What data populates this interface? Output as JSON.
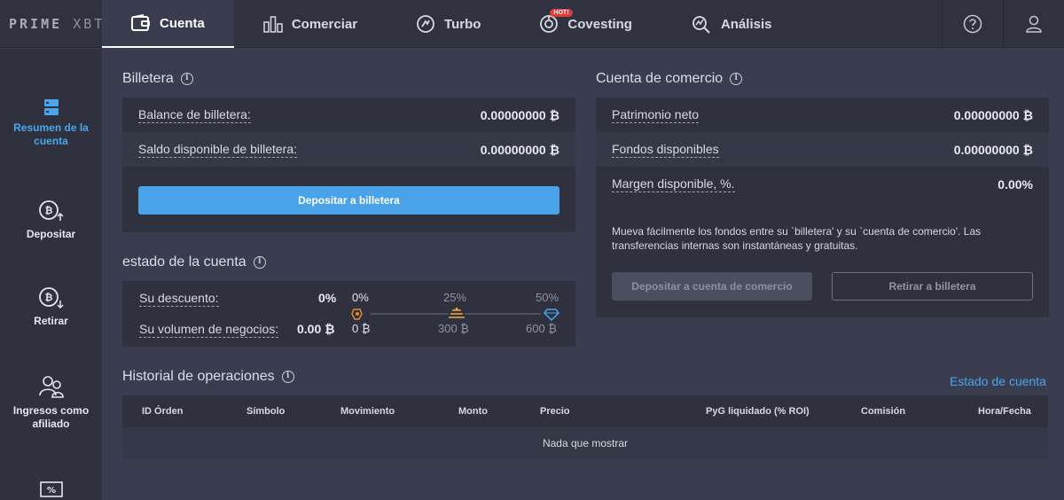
{
  "logo": {
    "brand": "PRIME",
    "suffix": "XBT"
  },
  "nav": [
    {
      "label": "Cuenta",
      "icon": "wallet-icon",
      "active": true
    },
    {
      "label": "Comerciar",
      "icon": "bar-chart-icon"
    },
    {
      "label": "Turbo",
      "icon": "turbo-icon"
    },
    {
      "label": "Covesting",
      "icon": "covesting-icon",
      "badge": "HOT!"
    },
    {
      "label": "Análisis",
      "icon": "analysis-icon"
    }
  ],
  "topright": {
    "help_icon": "help-icon",
    "user_icon": "user-icon"
  },
  "sidebar": [
    {
      "label": "Resumen de la cuenta",
      "icon": "summary-icon",
      "active": true
    },
    {
      "label": "Depositar",
      "icon": "deposit-icon"
    },
    {
      "label": "Retirar",
      "icon": "withdraw-icon"
    },
    {
      "label": "Ingresos como afiliado",
      "icon": "affiliate-icon"
    },
    {
      "label": "",
      "icon": "percent-icon"
    }
  ],
  "wallet": {
    "title": "Billetera",
    "balance_label": "Balance de billetera:",
    "balance_value": "0.00000000 ₿",
    "available_label": "Saldo disponible de billetera:",
    "available_value": "0.00000000 ₿",
    "deposit_button": "Depositar a billetera"
  },
  "account_status": {
    "title": "estado de la cuenta",
    "discount_label": "Su descuento:",
    "discount_value": "0%",
    "volume_label": "Su volumen de negocios:",
    "volume_value": "0.00 ₿",
    "tiers": [
      {
        "pct": "0%",
        "volume": "0 ₿",
        "icon": "tier-bronze-icon"
      },
      {
        "pct": "25%",
        "volume": "300 ₿",
        "icon": "tier-gold-icon"
      },
      {
        "pct": "50%",
        "volume": "600 ₿",
        "icon": "tier-diamond-icon"
      }
    ]
  },
  "trading_account": {
    "title": "Cuenta de comercio",
    "equity_label": "Patrimonio neto",
    "equity_value": "0.00000000 ₿",
    "funds_label": "Fondos disponibles",
    "funds_value": "0.00000000 ₿",
    "margin_label": "Margen disponible, %.",
    "margin_value": "0.00%",
    "note": "Mueva fácilmente los fondos entre su `billetera' y su `cuenta de comercio'. Las transferencias internas son instantáneas y gratuitas.",
    "deposit_button": "Depositar a cuenta de comercio",
    "withdraw_button": "Retirar a billetera"
  },
  "history": {
    "title": "Historial de operaciones",
    "statement_link": "Estado de cuenta",
    "columns": [
      "ID Órden",
      "Símbolo",
      "Movimiento",
      "Monto",
      "Precio",
      "PyG liquidado (% ROI)",
      "Comisión",
      "Hora/Fecha"
    ],
    "empty": "Nada que mostrar"
  },
  "colors": {
    "accent": "#4aa3e8",
    "bg": "#3a3d4f",
    "panel": "#2f313e",
    "hot": "#e23a3a"
  }
}
